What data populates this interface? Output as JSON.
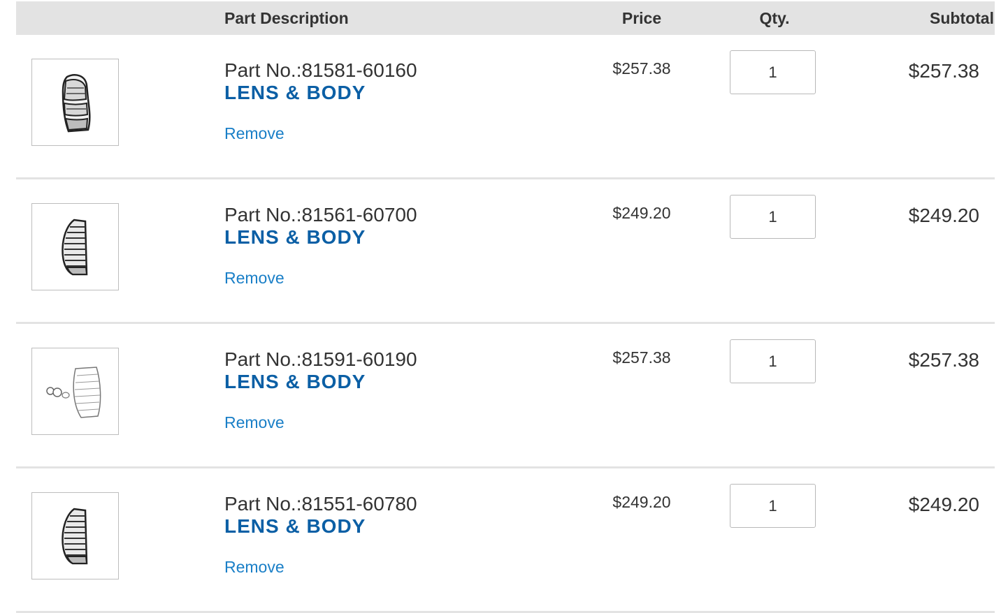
{
  "header": {
    "description": "Part Description",
    "price": "Price",
    "qty": "Qty.",
    "subtotal": "Subtotal"
  },
  "items": [
    {
      "part_no": "Part No.:81581-60160",
      "name": "LENS & BODY",
      "remove": "Remove",
      "price": "$257.38",
      "qty": "1",
      "subtotal": "$257.38",
      "image_icon": "tail-lamp-rear-icon"
    },
    {
      "part_no": "Part No.:81561-60700",
      "name": "LENS & BODY",
      "remove": "Remove",
      "price": "$249.20",
      "qty": "1",
      "subtotal": "$249.20",
      "image_icon": "tail-lamp-side-icon"
    },
    {
      "part_no": "Part No.:81591-60190",
      "name": "LENS & BODY",
      "remove": "Remove",
      "price": "$257.38",
      "qty": "1",
      "subtotal": "$257.38",
      "image_icon": "tail-lamp-exploded-icon"
    },
    {
      "part_no": "Part No.:81551-60780",
      "name": "LENS & BODY",
      "remove": "Remove",
      "price": "$249.20",
      "qty": "1",
      "subtotal": "$249.20",
      "image_icon": "tail-lamp-side-icon"
    }
  ],
  "colors": {
    "header_bg": "#e3e3e3",
    "part_name": "#0b5fa5",
    "link": "#1a7fc7"
  }
}
